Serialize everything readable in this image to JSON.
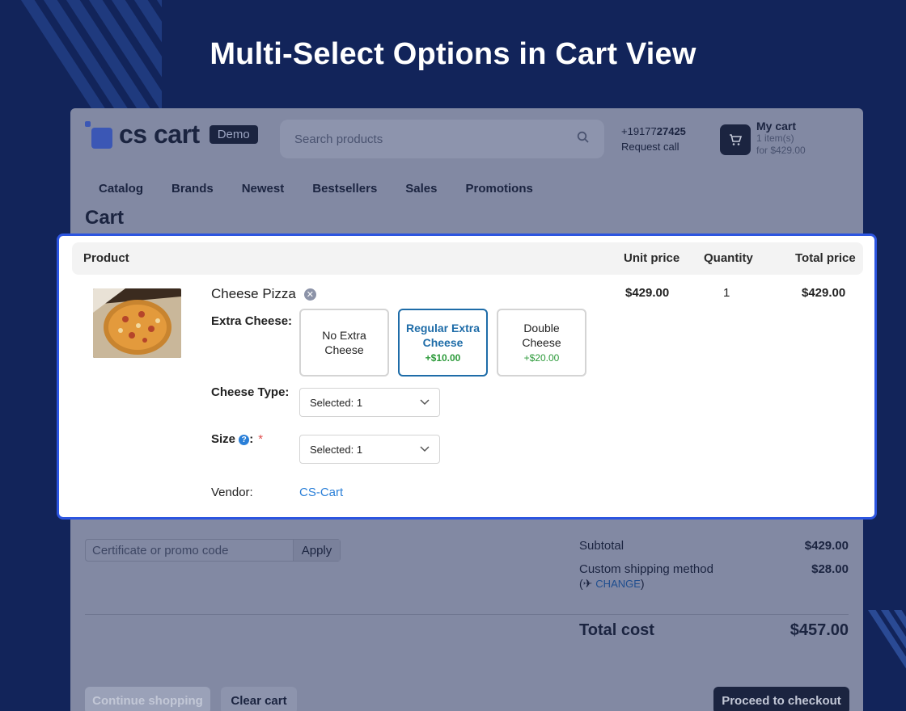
{
  "banner": {
    "title": "Multi-Select Options in Cart View"
  },
  "header": {
    "logo_text": "cs cart",
    "demo_badge": "Demo",
    "search_placeholder": "Search products",
    "phone_prefix": "+19177",
    "phone_bold": "27425",
    "request_call": "Request call",
    "cart_title": "My cart",
    "cart_items": "1 item(s)",
    "cart_total": "for $429.00"
  },
  "nav": [
    "Catalog",
    "Brands",
    "Newest",
    "Bestsellers",
    "Sales",
    "Promotions"
  ],
  "page_title": "Cart",
  "table": {
    "col_product": "Product",
    "col_unit_price": "Unit price",
    "col_quantity": "Quantity",
    "col_total_price": "Total price"
  },
  "item": {
    "name": "Cheese Pizza",
    "unit_price": "$429.00",
    "quantity": "1",
    "total_price": "$429.00",
    "extra_cheese_label": "Extra Cheese:",
    "extra_cheese_options": [
      {
        "label_1": "No Extra",
        "label_2": "Cheese",
        "price": ""
      },
      {
        "label_1": "Regular Extra",
        "label_2": "Cheese",
        "price": "+$10.00"
      },
      {
        "label_1": "Double",
        "label_2": "Cheese",
        "price": "+$20.00"
      }
    ],
    "cheese_type_label": "Cheese Type:",
    "cheese_type_value": "Selected: 1",
    "size_label": "Size",
    "size_suffix": ":",
    "size_value": "Selected: 1",
    "vendor_label": "Vendor:",
    "vendor_value": "CS-Cart"
  },
  "promo": {
    "placeholder": "Certificate or promo code",
    "apply": "Apply"
  },
  "totals": {
    "subtotal_label": "Subtotal",
    "subtotal_value": "$429.00",
    "shipping_label": "Custom shipping method",
    "shipping_value": "$28.00",
    "change_label": "CHANGE",
    "total_label": "Total cost",
    "total_value": "$457.00"
  },
  "buttons": {
    "continue": "Continue shopping",
    "clear": "Clear cart",
    "checkout": "Proceed to checkout"
  },
  "colors": {
    "background": "#12245a",
    "highlight_border": "#2c55e0",
    "selected_option": "#1e6ca8",
    "price_green": "#2c9a3a",
    "link_blue": "#2a7fd8"
  }
}
